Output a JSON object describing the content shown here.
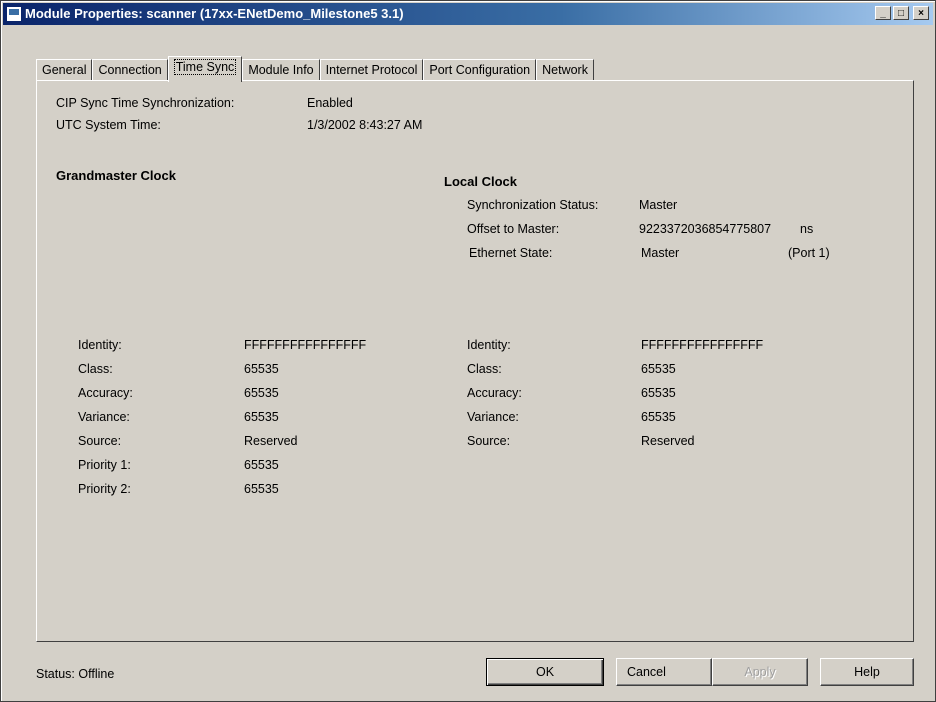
{
  "window": {
    "title": "Module Properties: scanner (17xx-ENetDemo_Milestone5 3.1)",
    "controls": [
      "_",
      "□",
      "×"
    ]
  },
  "tabs": [
    {
      "label": "General",
      "active": false
    },
    {
      "label": "Connection",
      "active": false
    },
    {
      "label": "Time Sync",
      "active": true
    },
    {
      "label": "Module Info",
      "active": false
    },
    {
      "label": "Internet Protocol",
      "active": false
    },
    {
      "label": "Port Configuration",
      "active": false
    },
    {
      "label": "Network",
      "active": false
    }
  ],
  "sync": {
    "cip_label": "CIP Sync Time Synchronization:",
    "cip_value": "Enabled",
    "utc_label": "UTC System Time:",
    "utc_value": "1/3/2002 8:43:27 AM"
  },
  "grandmaster": {
    "heading": "Grandmaster Clock",
    "rows": [
      {
        "label": "Identity:",
        "value": "FFFFFFFFFFFFFFFF"
      },
      {
        "label": "Class:",
        "value": "65535"
      },
      {
        "label": "Accuracy:",
        "value": "65535"
      },
      {
        "label": "Variance:",
        "value": "65535"
      },
      {
        "label": "Source:",
        "value": "Reserved"
      },
      {
        "label": "Priority 1:",
        "value": "65535"
      },
      {
        "label": "Priority 2:",
        "value": "65535"
      }
    ]
  },
  "local": {
    "heading": "Local Clock",
    "sync_status_label": "Synchronization Status:",
    "sync_status_value": "Master",
    "offset_label": "Offset to Master:",
    "offset_value": "9223372036854775807",
    "offset_unit": "ns",
    "ethernet_label": "Ethernet State:",
    "ethernet_value": "Master",
    "ethernet_port": "(Port 1)",
    "rows": [
      {
        "label": "Identity:",
        "value": "FFFFFFFFFFFFFFFF"
      },
      {
        "label": "Class:",
        "value": "65535"
      },
      {
        "label": "Accuracy:",
        "value": "65535"
      },
      {
        "label": "Variance:",
        "value": "65535"
      },
      {
        "label": "Source:",
        "value": "Reserved"
      }
    ]
  },
  "footer": {
    "status": "Status:  Offline",
    "ok": "OK",
    "cancel": "Cancel",
    "apply": "Apply",
    "help": "Help"
  }
}
